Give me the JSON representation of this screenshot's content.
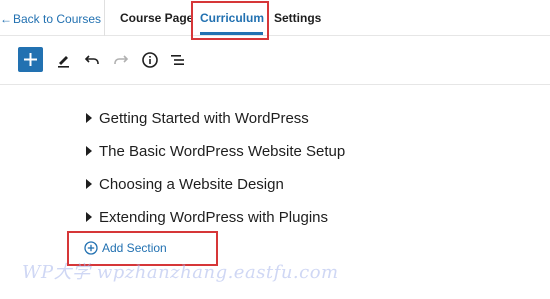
{
  "nav": {
    "back_label": "Back to Courses",
    "back_arrow": "←",
    "tabs": [
      {
        "label": "Course Page",
        "active": false
      },
      {
        "label": "Curriculum",
        "active": true
      },
      {
        "label": "Settings",
        "active": false
      }
    ]
  },
  "toolbar": {
    "icons": [
      "plus-icon",
      "pen-icon",
      "undo-icon",
      "redo-icon",
      "info-icon",
      "list-view-icon"
    ]
  },
  "sections": [
    {
      "title": "Getting Started with WordPress"
    },
    {
      "title": "The Basic WordPress Website Setup"
    },
    {
      "title": "Choosing a Website Design"
    },
    {
      "title": "Extending WordPress with Plugins"
    }
  ],
  "add_section": {
    "label": "Add Section"
  },
  "watermark": "WP大学 wpzhanzhang.eastfu.com",
  "colors": {
    "accent": "#2271b1",
    "highlight": "#d63638",
    "text": "#1e1e1e"
  }
}
